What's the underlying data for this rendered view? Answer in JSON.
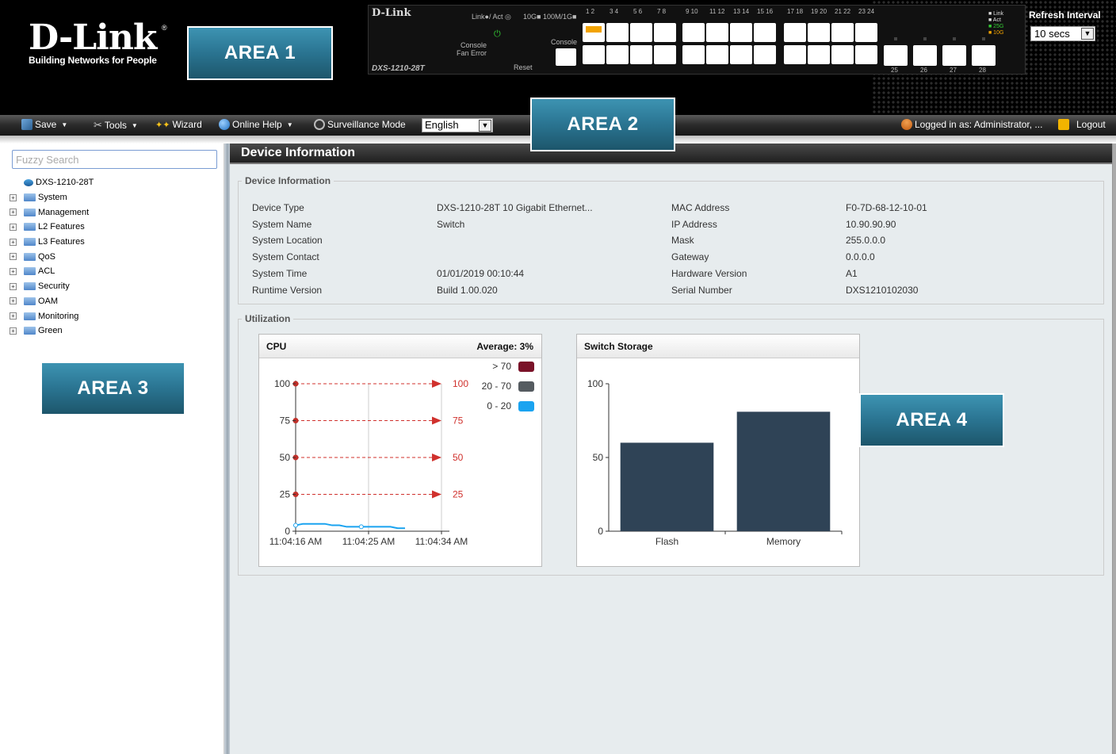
{
  "header": {
    "logo_text": "D-Link",
    "logo_reg": "®",
    "tagline": "Building Networks for People",
    "device_brand": "D-Link",
    "device_model": "DXS-1210-28T",
    "legend_link": "Link●/ Act ◎",
    "legend_speed": "10G■ 100M/1G■",
    "console_label": "Console",
    "fan_error_label": "Fan Error",
    "reset_label": "Reset",
    "console_port_label": "Console",
    "port_numbers_top": [
      "1",
      "2",
      "3",
      "4",
      "5",
      "6",
      "7",
      "8",
      "9",
      "10",
      "11",
      "12",
      "13",
      "14",
      "15",
      "16",
      "17",
      "18",
      "19",
      "20",
      "21",
      "22",
      "23",
      "24"
    ],
    "sfp_numbers": [
      "25",
      "26",
      "27",
      "28"
    ],
    "led_legend": [
      "Link",
      "Act",
      "25G",
      "10G"
    ],
    "refresh_label": "Refresh Interval",
    "refresh_value": "10 secs"
  },
  "areas": {
    "area1": "AREA 1",
    "area2": "AREA 2",
    "area3": "AREA 3",
    "area4": "AREA 4"
  },
  "toolbar": {
    "save": "Save",
    "tools": "Tools",
    "wizard": "Wizard",
    "online_help": "Online Help",
    "surveillance": "Surveillance Mode",
    "language": "English",
    "logged_in": "Logged in as: Administrator, ...",
    "logout": "Logout"
  },
  "sidebar": {
    "search_placeholder": "Fuzzy Search",
    "root": "DXS-1210-28T",
    "items": [
      "System",
      "Management",
      "L2 Features",
      "L3 Features",
      "QoS",
      "ACL",
      "Security",
      "OAM",
      "Monitoring",
      "Green"
    ]
  },
  "main": {
    "title": "Device Information",
    "info_group": "Device Information",
    "info_left": [
      {
        "label": "Device Type",
        "value": "DXS-1210-28T 10 Gigabit Ethernet..."
      },
      {
        "label": "System Name",
        "value": "Switch"
      },
      {
        "label": "System Location",
        "value": ""
      },
      {
        "label": "System Contact",
        "value": ""
      },
      {
        "label": "System Time",
        "value": "01/01/2019 00:10:44"
      },
      {
        "label": "Runtime Version",
        "value": "Build 1.00.020"
      }
    ],
    "info_right": [
      {
        "label": "MAC Address",
        "value": "F0-7D-68-12-10-01"
      },
      {
        "label": "IP Address",
        "value": "10.90.90.90"
      },
      {
        "label": "Mask",
        "value": "255.0.0.0"
      },
      {
        "label": "Gateway",
        "value": "0.0.0.0"
      },
      {
        "label": "Hardware Version",
        "value": "A1"
      },
      {
        "label": "Serial Number",
        "value": "DXS1210102030"
      }
    ],
    "utilization_group": "Utilization"
  },
  "chart_data": [
    {
      "type": "line",
      "title": "CPU",
      "subtitle": "Average: 3%",
      "x_ticks": [
        "11:04:16 AM",
        "11:04:25 AM",
        "11:04:34 AM"
      ],
      "y_ticks": [
        0,
        25,
        50,
        75,
        100
      ],
      "ylim": [
        0,
        100
      ],
      "threshold_lines": [
        100,
        75,
        50,
        25
      ],
      "legend": [
        {
          "label": "> 70",
          "color": "#7a1228"
        },
        {
          "label": "20 - 70",
          "color": "#555b60"
        },
        {
          "label": "0 - 20",
          "color": "#1aa3f0"
        }
      ],
      "series": [
        {
          "x": [
            0,
            1,
            2,
            3,
            4,
            5,
            6,
            7,
            8,
            9,
            10,
            11,
            12,
            13,
            14,
            15
          ],
          "values": [
            4,
            5,
            5,
            5,
            5,
            4,
            4,
            3,
            3,
            3,
            3,
            3,
            3,
            3,
            2,
            2
          ]
        }
      ],
      "x_range": [
        0,
        20
      ]
    },
    {
      "type": "bar",
      "title": "Switch Storage",
      "categories": [
        "Flash",
        "Memory"
      ],
      "values": [
        60,
        81
      ],
      "ylim": [
        0,
        100
      ],
      "y_ticks": [
        0,
        50,
        100
      ],
      "color": "#2f4356"
    }
  ]
}
